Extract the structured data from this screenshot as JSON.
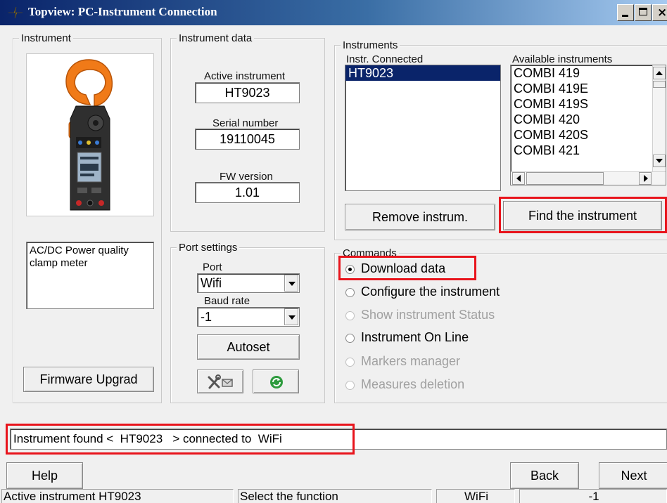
{
  "window": {
    "title": "Topview: PC-Instrument Connection",
    "accent_color": "#0a246a",
    "highlight_color": "#e8141c"
  },
  "instrument": {
    "group_label": "Instrument",
    "image_icon": "clamp-meter-image",
    "description": "AC/DC Power quality clamp meter",
    "firmware_button": "Firmware Upgrad"
  },
  "instrument_data": {
    "group_label": "Instrument data",
    "active_label": "Active instrument",
    "active_value": "HT9023",
    "serial_label": "Serial number",
    "serial_value": "19110045",
    "fw_label": "FW version",
    "fw_value": "1.01"
  },
  "instruments": {
    "group_label": "Instruments",
    "connected_label": "Instr. Connected",
    "connected": [
      "HT9023"
    ],
    "available_label": "Available instruments",
    "available": [
      "COMBI 419",
      "COMBI 419E",
      "COMBI 419S",
      "COMBI 420",
      "COMBI 420S",
      "COMBI 421"
    ],
    "remove_button": "Remove instrum.",
    "find_button": "Find the instrument"
  },
  "port_settings": {
    "group_label": "Port settings",
    "port_label": "Port",
    "port_value": "Wifi",
    "baud_label": "Baud rate",
    "baud_value": "-1",
    "autoset_button": "Autoset",
    "tools_icon": "tools-icon",
    "refresh_icon": "refresh-icon"
  },
  "commands": {
    "group_label": "Commands",
    "options": [
      {
        "label": "Download data",
        "selected": true,
        "enabled": true
      },
      {
        "label": "Configure the instrument",
        "selected": false,
        "enabled": true
      },
      {
        "label": "Show instrument Status",
        "selected": false,
        "enabled": false
      },
      {
        "label": "Instrument On Line",
        "selected": false,
        "enabled": true
      },
      {
        "label": "Markers manager",
        "selected": false,
        "enabled": false
      },
      {
        "label": "Measures deletion",
        "selected": false,
        "enabled": false
      }
    ]
  },
  "message": "Instrument found <  HT9023   > connected to  WiFi",
  "buttons": {
    "help": "Help",
    "back": "Back",
    "next": "Next"
  },
  "statusbar": {
    "active": "Active instrument HT9023",
    "function": "Select the function",
    "connection": "WiFi",
    "value": "-1"
  }
}
